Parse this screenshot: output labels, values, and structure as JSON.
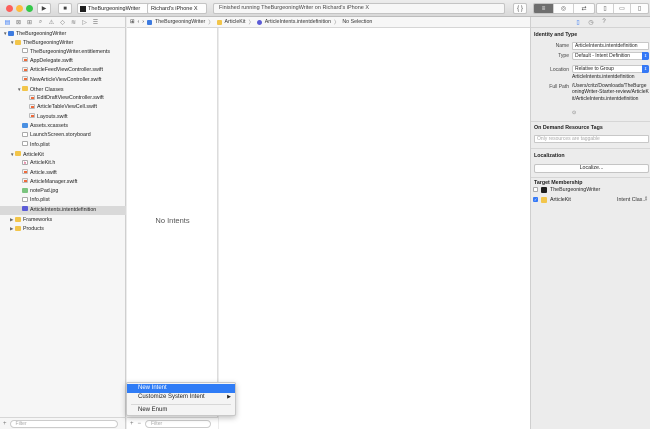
{
  "toolbar": {
    "scheme_target": "TheBurgeoningWriter",
    "device": "Richard's iPhone X",
    "status": "Finished running TheBurgeoningWriter on Richard's iPhone X",
    "code_review_label": "{ }"
  },
  "navigator": {
    "tree": [
      {
        "label": "TheBurgeoningWriter",
        "depth": 0,
        "disclosure": "open",
        "icon": "project-icon"
      },
      {
        "label": "TheBurgeoningWriter",
        "depth": 1,
        "disclosure": "open",
        "icon": "folder-icon"
      },
      {
        "label": "TheBurgeoningWriter.entitlements",
        "depth": 2,
        "disclosure": "",
        "icon": "plain-file-icon"
      },
      {
        "label": "AppDelegate.swift",
        "depth": 2,
        "disclosure": "",
        "icon": "swift-file-icon"
      },
      {
        "label": "ArticleFeedViewController.swift",
        "depth": 2,
        "disclosure": "",
        "icon": "swift-file-icon"
      },
      {
        "label": "NewArticleViewController.swift",
        "depth": 2,
        "disclosure": "",
        "icon": "swift-file-icon"
      },
      {
        "label": "Other Classes",
        "depth": 2,
        "disclosure": "open",
        "icon": "folder-icon"
      },
      {
        "label": "EditDraftViewController.swift",
        "depth": 3,
        "disclosure": "",
        "icon": "swift-file-icon"
      },
      {
        "label": "ArticleTableViewCell.swift",
        "depth": 3,
        "disclosure": "",
        "icon": "swift-file-icon"
      },
      {
        "label": "Layouts.swift",
        "depth": 3,
        "disclosure": "",
        "icon": "swift-file-icon"
      },
      {
        "label": "Assets.xcassets",
        "depth": 2,
        "disclosure": "",
        "icon": "assets-icon"
      },
      {
        "label": "LaunchScreen.storyboard",
        "depth": 2,
        "disclosure": "",
        "icon": "plain-file-icon"
      },
      {
        "label": "Info.plist",
        "depth": 2,
        "disclosure": "",
        "icon": "plain-file-icon"
      },
      {
        "label": "ArticleKit",
        "depth": 1,
        "disclosure": "open",
        "icon": "folder-icon"
      },
      {
        "label": "ArticleKit.h",
        "depth": 2,
        "disclosure": "",
        "icon": "header-file-icon"
      },
      {
        "label": "Article.swift",
        "depth": 2,
        "disclosure": "",
        "icon": "swift-file-icon"
      },
      {
        "label": "ArticleManager.swift",
        "depth": 2,
        "disclosure": "",
        "icon": "swift-file-icon"
      },
      {
        "label": "notePad.jpg",
        "depth": 2,
        "disclosure": "",
        "icon": "image-file-icon"
      },
      {
        "label": "Info.plist",
        "depth": 2,
        "disclosure": "",
        "icon": "plain-file-icon"
      },
      {
        "label": "ArticleIntents.intentdefinition",
        "depth": 2,
        "disclosure": "",
        "icon": "intent-file-icon",
        "selected": true
      },
      {
        "label": "Frameworks",
        "depth": 1,
        "disclosure": "closed",
        "icon": "folder-icon"
      },
      {
        "label": "Products",
        "depth": 1,
        "disclosure": "closed",
        "icon": "folder-icon"
      }
    ],
    "filter_placeholder": "Filter"
  },
  "jumpbar": {
    "crumbs": [
      "TheBurgeoningWriter",
      "ArticleKit",
      "ArticleIntents.intentdefinition",
      "No Selection"
    ]
  },
  "editor": {
    "empty_label": "No Intents",
    "filter_placeholder": "Filter",
    "add_label": "+",
    "remove_label": "−"
  },
  "popup": {
    "items": [
      "New Intent",
      "Customize System Intent",
      "New Enum"
    ],
    "highlighted": "New Intent"
  },
  "inspector": {
    "identity_header": "Identity and Type",
    "name_label": "Name",
    "name_value": "ArticleIntents.intentdefinition",
    "type_label": "Type",
    "type_value": "Default - Intent Definition",
    "location_label": "Location",
    "location_value": "Relative to Group",
    "location_file": "ArticleIntents.intentdefinition",
    "fullpath_label": "Full Path",
    "fullpath_value": "/Users/critz/Downloads/TheBurgeoningWriter-Starter-review/ArticleKit/ArticleIntents.intentdefinition",
    "odr_header": "On Demand Resource Tags",
    "odr_placeholder": "Only resources are taggable",
    "localization_header": "Localization",
    "localize_button": "Localize...",
    "target_header": "Target Membership",
    "targets": [
      {
        "name": "TheBurgeoningWriter",
        "checked": false,
        "extra": ""
      },
      {
        "name": "ArticleKit",
        "checked": true,
        "extra": "Intent Clas..."
      }
    ]
  },
  "colors": {
    "accent": "#3478f6",
    "selection_row": "#d9d9d9",
    "menu_highlight": "#2f7cf6",
    "folder": "#f2c54a"
  }
}
